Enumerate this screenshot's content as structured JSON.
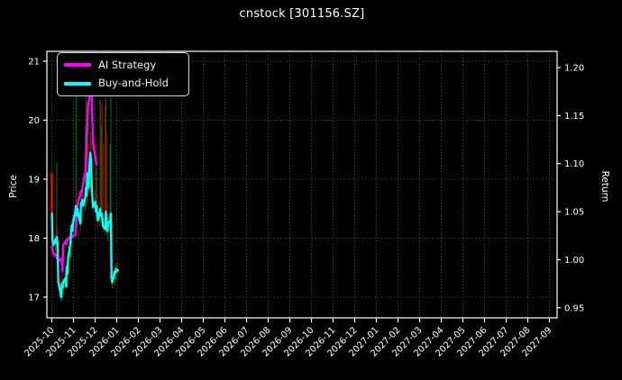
{
  "title": "cnstock [301156.SZ]",
  "legend": {
    "items": [
      {
        "label": "AI Strategy",
        "color": "#ff00ff"
      },
      {
        "label": "Buy-and-Hold",
        "color": "#00ffff"
      }
    ]
  },
  "chart_data": {
    "type": "candlestick_with_lines",
    "title": "cnstock [301156.SZ]",
    "grid": "dotted",
    "legend_position": "upper left",
    "x_axis": {
      "start": "2025-10",
      "end": "2027-09",
      "tick_labels": [
        "2025-10",
        "2025-11",
        "2025-12",
        "2026-01",
        "2026-02",
        "2026-03",
        "2026-04",
        "2026-05",
        "2026-06",
        "2026-07",
        "2026-08",
        "2026-09",
        "2026-10",
        "2026-11",
        "2026-12",
        "2027-01",
        "2027-02",
        "2027-03",
        "2027-04",
        "2027-05",
        "2027-06",
        "2027-07",
        "2027-08",
        "2027-09"
      ]
    },
    "price_axis": {
      "label": "Price",
      "ticks": [
        21,
        20,
        19,
        18,
        17
      ],
      "approx_range": [
        16.6,
        21.2
      ]
    },
    "return_axis": {
      "label": "Return",
      "tick_labels": [
        "1.20",
        "1.15",
        "1.10",
        "1.05",
        "1.00",
        "0.95"
      ],
      "approx_range": [
        0.935,
        1.217
      ]
    },
    "data_span": {
      "first_date": "2025-10-01",
      "last_date": "2026-01-02"
    },
    "candles_ohlc": {
      "encoding": "[day_offset_from_2025-10-01, open, high, low, close]",
      "rows": [
        [
          0,
          19.1,
          19.22,
          18.2,
          18.42
        ],
        [
          1,
          18.42,
          18.5,
          17.85,
          17.95
        ],
        [
          2,
          17.95,
          18.12,
          17.72,
          17.88
        ],
        [
          5,
          17.88,
          18.05,
          17.7,
          17.98
        ],
        [
          6,
          17.98,
          18.2,
          17.85,
          17.92
        ],
        [
          7,
          17.9,
          19.28,
          17.82,
          18.02
        ],
        [
          8,
          18.02,
          18.15,
          17.78,
          17.9
        ],
        [
          9,
          17.95,
          18.0,
          17.18,
          17.26
        ],
        [
          12,
          17.26,
          17.4,
          17.02,
          17.08
        ],
        [
          13,
          17.1,
          17.35,
          16.93,
          17.0
        ],
        [
          14,
          17.0,
          17.28,
          16.95,
          17.22
        ],
        [
          15,
          17.22,
          17.45,
          17.1,
          17.15
        ],
        [
          16,
          17.15,
          17.3,
          17.05,
          17.26
        ],
        [
          19,
          17.26,
          17.5,
          17.2,
          17.32
        ],
        [
          20,
          17.32,
          17.42,
          17.12,
          17.18
        ],
        [
          21,
          17.18,
          17.6,
          17.15,
          17.52
        ],
        [
          22,
          17.52,
          17.65,
          17.35,
          17.4
        ],
        [
          23,
          17.4,
          17.72,
          17.38,
          17.68
        ],
        [
          26,
          17.68,
          17.95,
          17.6,
          17.9
        ],
        [
          27,
          17.9,
          18.15,
          17.82,
          18.1
        ],
        [
          28,
          18.1,
          18.3,
          17.95,
          18.22
        ],
        [
          29,
          18.22,
          18.4,
          18.05,
          18.12
        ],
        [
          30,
          18.12,
          18.35,
          18.0,
          18.28
        ],
        [
          33,
          18.28,
          18.55,
          18.15,
          18.45
        ],
        [
          34,
          18.35,
          20.6,
          18.2,
          18.55
        ],
        [
          35,
          18.55,
          18.8,
          18.3,
          18.38
        ],
        [
          36,
          18.38,
          18.6,
          18.2,
          18.5
        ],
        [
          37,
          18.5,
          18.72,
          18.35,
          18.42
        ],
        [
          40,
          18.42,
          18.55,
          18.1,
          18.25
        ],
        [
          41,
          18.25,
          18.7,
          18.2,
          18.6
        ],
        [
          42,
          18.6,
          18.85,
          18.45,
          18.55
        ],
        [
          43,
          18.55,
          18.8,
          18.4,
          18.65
        ],
        [
          44,
          18.65,
          19.1,
          18.5,
          18.55
        ],
        [
          47,
          18.55,
          19.9,
          18.45,
          18.7
        ],
        [
          48,
          18.7,
          20.4,
          18.6,
          18.85
        ],
        [
          49,
          18.85,
          20.3,
          18.55,
          18.72
        ],
        [
          50,
          18.72,
          19.5,
          18.6,
          19.1
        ],
        [
          51,
          19.1,
          19.6,
          18.7,
          18.85
        ],
        [
          54,
          18.85,
          19.8,
          18.8,
          19.45
        ],
        [
          55,
          19.45,
          19.7,
          19.1,
          19.35
        ],
        [
          56,
          19.35,
          19.45,
          18.75,
          18.9
        ],
        [
          57,
          18.9,
          19.1,
          18.55,
          18.68
        ],
        [
          58,
          18.68,
          18.85,
          18.4,
          18.52
        ],
        [
          61,
          18.52,
          18.8,
          18.45,
          18.62
        ],
        [
          62,
          18.62,
          19.6,
          18.35,
          18.45
        ],
        [
          63,
          18.45,
          19.2,
          18.3,
          18.55
        ],
        [
          64,
          18.55,
          18.75,
          18.25,
          18.38
        ],
        [
          65,
          18.38,
          18.6,
          18.15,
          18.3
        ],
        [
          68,
          18.3,
          20.35,
          18.2,
          18.5
        ],
        [
          69,
          18.5,
          20.28,
          18.3,
          18.38
        ],
        [
          70,
          18.38,
          19.9,
          18.25,
          18.42
        ],
        [
          71,
          18.42,
          20.3,
          18.3,
          18.35
        ],
        [
          72,
          18.35,
          19.6,
          18.1,
          18.2
        ],
        [
          75,
          18.2,
          20.25,
          18.05,
          18.15
        ],
        [
          76,
          18.15,
          20.38,
          18.1,
          18.45
        ],
        [
          77,
          18.45,
          19.8,
          18.2,
          18.3
        ],
        [
          78,
          18.3,
          18.6,
          18.05,
          18.12
        ],
        [
          79,
          18.12,
          18.4,
          17.95,
          18.25
        ],
        [
          82,
          18.25,
          19.6,
          18.1,
          18.3
        ],
        [
          83,
          18.3,
          20.38,
          18.15,
          18.42
        ],
        [
          84,
          18.42,
          18.42,
          17.2,
          17.3
        ],
        [
          85,
          17.3,
          17.6,
          17.15,
          17.25
        ],
        [
          86,
          17.45,
          18.28,
          17.15,
          17.3
        ],
        [
          89,
          17.3,
          17.55,
          17.2,
          17.45
        ],
        [
          90,
          17.45,
          17.58,
          17.35,
          17.42
        ],
        [
          91,
          17.42,
          17.55,
          17.3,
          17.48
        ],
        [
          93,
          17.48,
          17.6,
          17.35,
          17.45
        ]
      ]
    },
    "series": [
      {
        "name": "AI Strategy",
        "color": "#ff00ff",
        "points": [
          [
            0,
            17.86
          ],
          [
            1,
            17.8
          ],
          [
            2,
            17.74
          ],
          [
            5,
            17.7
          ],
          [
            6,
            17.72
          ],
          [
            7,
            17.66
          ],
          [
            8,
            17.68
          ],
          [
            9,
            17.62
          ],
          [
            12,
            17.64
          ],
          [
            13,
            17.6
          ],
          [
            14,
            17.66
          ],
          [
            15,
            17.44
          ],
          [
            16,
            17.88
          ],
          [
            19,
            17.94
          ],
          [
            20,
            17.9
          ],
          [
            21,
            17.98
          ],
          [
            22,
            17.96
          ],
          [
            23,
            18.0
          ],
          [
            26,
            18.02
          ],
          [
            27,
            18.04
          ],
          [
            28,
            18.02
          ],
          [
            29,
            18.05
          ],
          [
            30,
            18.03
          ],
          [
            33,
            18.05
          ],
          [
            34,
            18.22
          ],
          [
            35,
            18.35
          ],
          [
            36,
            18.5
          ],
          [
            37,
            18.62
          ],
          [
            40,
            18.72
          ],
          [
            41,
            18.8
          ],
          [
            42,
            18.78
          ],
          [
            43,
            18.84
          ],
          [
            44,
            18.92
          ],
          [
            47,
            19.1
          ],
          [
            48,
            19.3
          ],
          [
            49,
            19.55
          ],
          [
            50,
            19.9
          ],
          [
            51,
            20.25
          ],
          [
            54,
            20.48
          ],
          [
            55,
            20.55
          ],
          [
            56,
            20.45
          ],
          [
            57,
            20.05
          ],
          [
            58,
            19.6
          ],
          [
            61,
            19.38
          ],
          [
            62,
            19.3
          ],
          [
            63,
            19.25
          ]
        ]
      },
      {
        "name": "Buy-and-Hold",
        "color": "#00ffff",
        "points": [
          [
            0,
            18.42
          ],
          [
            1,
            17.95
          ],
          [
            2,
            17.88
          ],
          [
            5,
            17.98
          ],
          [
            6,
            17.92
          ],
          [
            7,
            18.02
          ],
          [
            8,
            17.9
          ],
          [
            9,
            17.26
          ],
          [
            12,
            17.08
          ],
          [
            13,
            17.0
          ],
          [
            14,
            17.22
          ],
          [
            15,
            17.15
          ],
          [
            16,
            17.26
          ],
          [
            19,
            17.32
          ],
          [
            20,
            17.18
          ],
          [
            21,
            17.52
          ],
          [
            22,
            17.4
          ],
          [
            23,
            17.68
          ],
          [
            26,
            17.9
          ],
          [
            27,
            18.1
          ],
          [
            28,
            18.22
          ],
          [
            29,
            18.12
          ],
          [
            30,
            18.28
          ],
          [
            33,
            18.45
          ],
          [
            34,
            18.55
          ],
          [
            35,
            18.38
          ],
          [
            36,
            18.5
          ],
          [
            37,
            18.42
          ],
          [
            40,
            18.25
          ],
          [
            41,
            18.6
          ],
          [
            42,
            18.55
          ],
          [
            43,
            18.65
          ],
          [
            44,
            18.55
          ],
          [
            47,
            18.7
          ],
          [
            48,
            18.85
          ],
          [
            49,
            18.72
          ],
          [
            50,
            19.1
          ],
          [
            51,
            18.85
          ],
          [
            54,
            19.45
          ],
          [
            55,
            19.35
          ],
          [
            56,
            18.9
          ],
          [
            57,
            18.68
          ],
          [
            58,
            18.52
          ],
          [
            61,
            18.62
          ],
          [
            62,
            18.45
          ],
          [
            63,
            18.55
          ],
          [
            64,
            18.38
          ],
          [
            65,
            18.3
          ],
          [
            68,
            18.5
          ],
          [
            69,
            18.38
          ],
          [
            70,
            18.42
          ],
          [
            71,
            18.35
          ],
          [
            72,
            18.2
          ],
          [
            75,
            18.15
          ],
          [
            76,
            18.45
          ],
          [
            77,
            18.3
          ],
          [
            78,
            18.12
          ],
          [
            79,
            18.25
          ],
          [
            82,
            18.3
          ],
          [
            83,
            18.42
          ],
          [
            84,
            17.3
          ],
          [
            85,
            17.25
          ],
          [
            86,
            17.3
          ],
          [
            89,
            17.45
          ],
          [
            90,
            17.42
          ],
          [
            91,
            17.48
          ],
          [
            93,
            17.45
          ]
        ]
      }
    ],
    "colors": {
      "background": "#000000",
      "text": "#ffffff",
      "grid": "#4d4d4d",
      "spine": "#ffffff",
      "up_body": "#00a400",
      "up_wick": "#007300",
      "down_body": "#ff0c00",
      "down_wick": "#9b0000",
      "ai_strategy_line": "#ff00ff",
      "buy_and_hold_line": "#00ffff"
    }
  }
}
